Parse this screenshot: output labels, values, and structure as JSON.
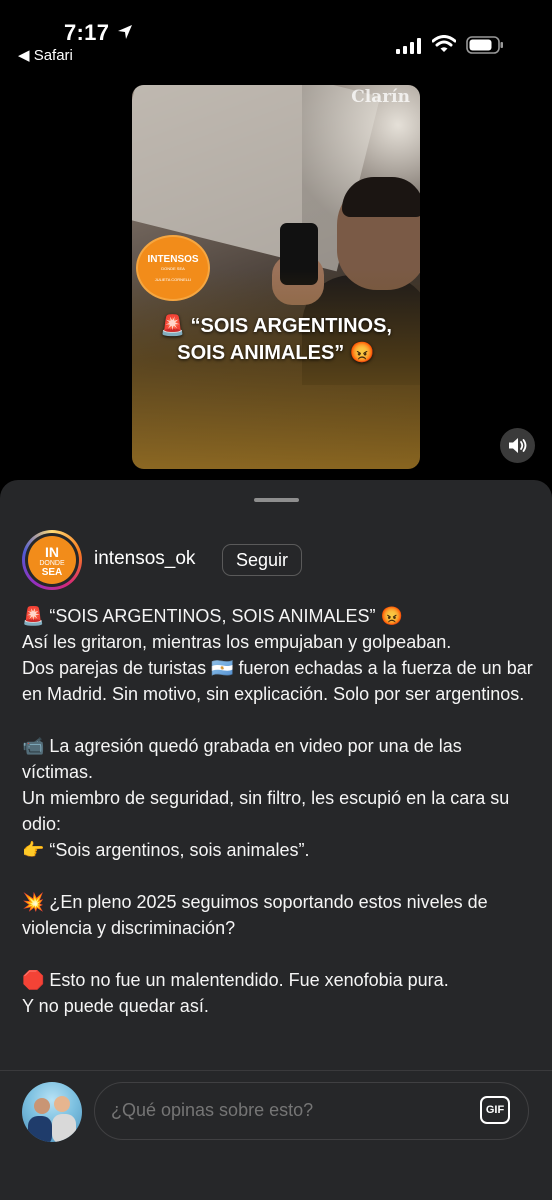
{
  "status_bar": {
    "time": "7:17",
    "back_label": "◀ Safari"
  },
  "video": {
    "watermark": "Clarín",
    "badge": {
      "title": "INTENSOS",
      "subtitle": "DONDE SEA",
      "name": "JULIETA CORNELLI"
    },
    "caption_line1": "🚨 “SOIS ARGENTINOS,",
    "caption_line2": "SOIS ANIMALES” 😡"
  },
  "post": {
    "avatar": {
      "line1": "IN",
      "line2": "DONDE",
      "line3": "SEA"
    },
    "username": "intensos_ok",
    "follow_label": "Seguir",
    "caption": {
      "p1": "🚨 “SOIS ARGENTINOS, SOIS ANIMALES” 😡",
      "p2": "Así les gritaron, mientras los empujaban y golpeaban.",
      "p3": "Dos parejas de turistas 🇦🇷 fueron echadas a la fuerza de un bar en Madrid. Sin motivo, sin explicación. Solo por ser argentinos.",
      "p4": "📹 La agresión quedó grabada en video por una de las víctimas.",
      "p5": "Un miembro de seguridad, sin filtro, les escupió en la cara su odio:",
      "p6": "👉 “Sois argentinos, sois animales”.",
      "p7": "💥 ¿En pleno 2025 seguimos soportando estos niveles de violencia y discriminación?",
      "p8": "🛑 Esto no fue un malentendido. Fue xenofobia pura.",
      "p9": "Y no puede quedar así."
    }
  },
  "composer": {
    "placeholder": "¿Qué opinas sobre esto?",
    "gif_label": "GIF"
  },
  "icons": {
    "location": "location-arrow-icon",
    "signal": "cellular-signal-icon",
    "wifi": "wifi-icon",
    "battery": "battery-icon",
    "mute": "speaker-icon",
    "gif": "gif-icon"
  }
}
